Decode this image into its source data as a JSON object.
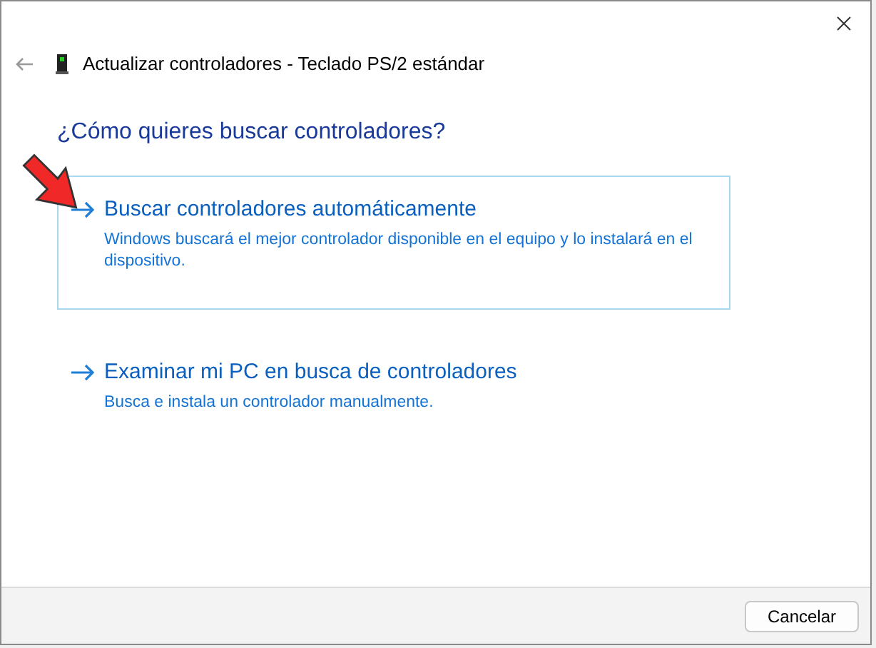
{
  "window": {
    "title": "Actualizar controladores - Teclado PS/2 estándar"
  },
  "heading": "¿Cómo quieres buscar controladores?",
  "options": [
    {
      "title": "Buscar controladores automáticamente",
      "description": "Windows buscará el mejor controlador disponible en el equipo y lo instalará en el dispositivo.",
      "selected": true
    },
    {
      "title": "Examinar mi PC en busca de controladores",
      "description": "Busca e instala un controlador manualmente.",
      "selected": false
    }
  ],
  "annotation": {
    "kind": "arrow"
  },
  "buttons": [
    "Cancelar"
  ]
}
